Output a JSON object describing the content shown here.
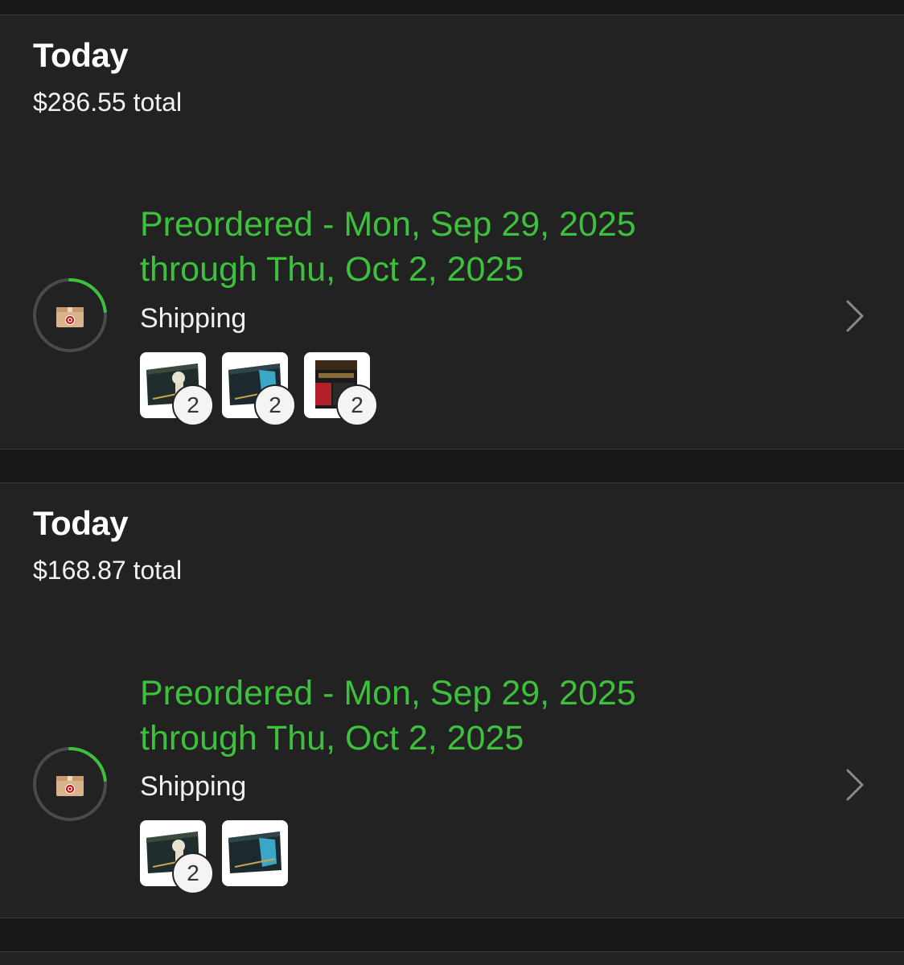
{
  "orders": [
    {
      "title": "Today",
      "total": "$286.55 total",
      "status_line_1": "Preordered - Mon, Sep 29, 2025",
      "status_line_2": "through Thu, Oct 2, 2025",
      "shipping_label": "Shipping",
      "progress_fraction": 0.22,
      "items": [
        {
          "art": "box-dark-figure",
          "qty": "2"
        },
        {
          "art": "box-dark-blue",
          "qty": "2"
        },
        {
          "art": "box-red-black",
          "qty": "2"
        }
      ]
    },
    {
      "title": "Today",
      "total": "$168.87 total",
      "status_line_1": "Preordered - Mon, Sep 29, 2025",
      "status_line_2": "through Thu, Oct 2, 2025",
      "shipping_label": "Shipping",
      "progress_fraction": 0.22,
      "items": [
        {
          "art": "box-dark-figure",
          "qty": "2"
        },
        {
          "art": "box-dark-blue",
          "qty": ""
        }
      ]
    }
  ],
  "colors": {
    "status_green": "#3dc13c",
    "card_bg": "#222222",
    "page_bg": "#171717",
    "brand_red": "#cc0000"
  },
  "icons": {
    "status": "package-box-icon",
    "chevron": "chevron-right-icon"
  }
}
